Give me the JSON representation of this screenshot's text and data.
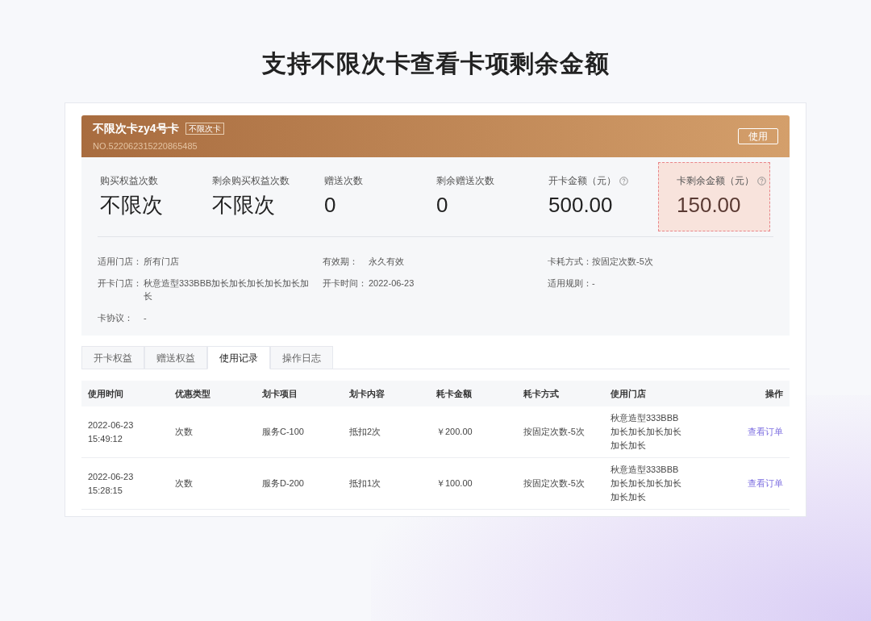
{
  "headline": "支持不限次卡查看卡项剩余金额",
  "card": {
    "title": "不限次卡zy4号卡",
    "tag": "不限次卡",
    "number": "NO.522062315220865485",
    "action": "使用"
  },
  "stats": [
    {
      "label": "购买权益次数",
      "value": "不限次",
      "help": false,
      "highlighted": false
    },
    {
      "label": "剩余购买权益次数",
      "value": "不限次",
      "help": false,
      "highlighted": false
    },
    {
      "label": "赠送次数",
      "value": "0",
      "help": false,
      "highlighted": false
    },
    {
      "label": "剩余赠送次数",
      "value": "0",
      "help": false,
      "highlighted": false
    },
    {
      "label": "开卡金额（元）",
      "value": "500.00",
      "help": true,
      "highlighted": false
    },
    {
      "label": "卡剩余金额（元）",
      "value": "150.00",
      "help": true,
      "highlighted": true
    }
  ],
  "details": [
    {
      "label": "适用门店：",
      "value": "所有门店"
    },
    {
      "label": "有效期：",
      "value": "永久有效"
    },
    {
      "label": "卡耗方式：",
      "value": "按固定次数-5次"
    },
    {
      "label": "开卡门店：",
      "value": "秋意造型333BBB加长加长加长加长加长加长"
    },
    {
      "label": "开卡时间：",
      "value": "2022-06-23"
    },
    {
      "label": "适用规则：",
      "value": "-"
    },
    {
      "label": "卡协议：",
      "value": "-"
    }
  ],
  "tabs": [
    {
      "label": "开卡权益",
      "selected": false
    },
    {
      "label": "赠送权益",
      "selected": false
    },
    {
      "label": "使用记录",
      "selected": true
    },
    {
      "label": "操作日志",
      "selected": false
    }
  ],
  "table": {
    "columns": [
      "使用时间",
      "优惠类型",
      "划卡项目",
      "划卡内容",
      "耗卡金额",
      "耗卡方式",
      "使用门店",
      "操作"
    ],
    "rows": [
      [
        "2022-06-23 15:49:12",
        "次数",
        "服务C-100",
        "抵扣2次",
        "￥200.00",
        "按固定次数-5次",
        "秋意造型333BBB加长加长加长加长加长加长",
        "查看订单"
      ],
      [
        "2022-06-23 15:28:15",
        "次数",
        "服务D-200",
        "抵扣1次",
        "￥100.00",
        "按固定次数-5次",
        "秋意造型333BBB加长加长加长加长加长加长",
        "查看订单"
      ]
    ]
  }
}
